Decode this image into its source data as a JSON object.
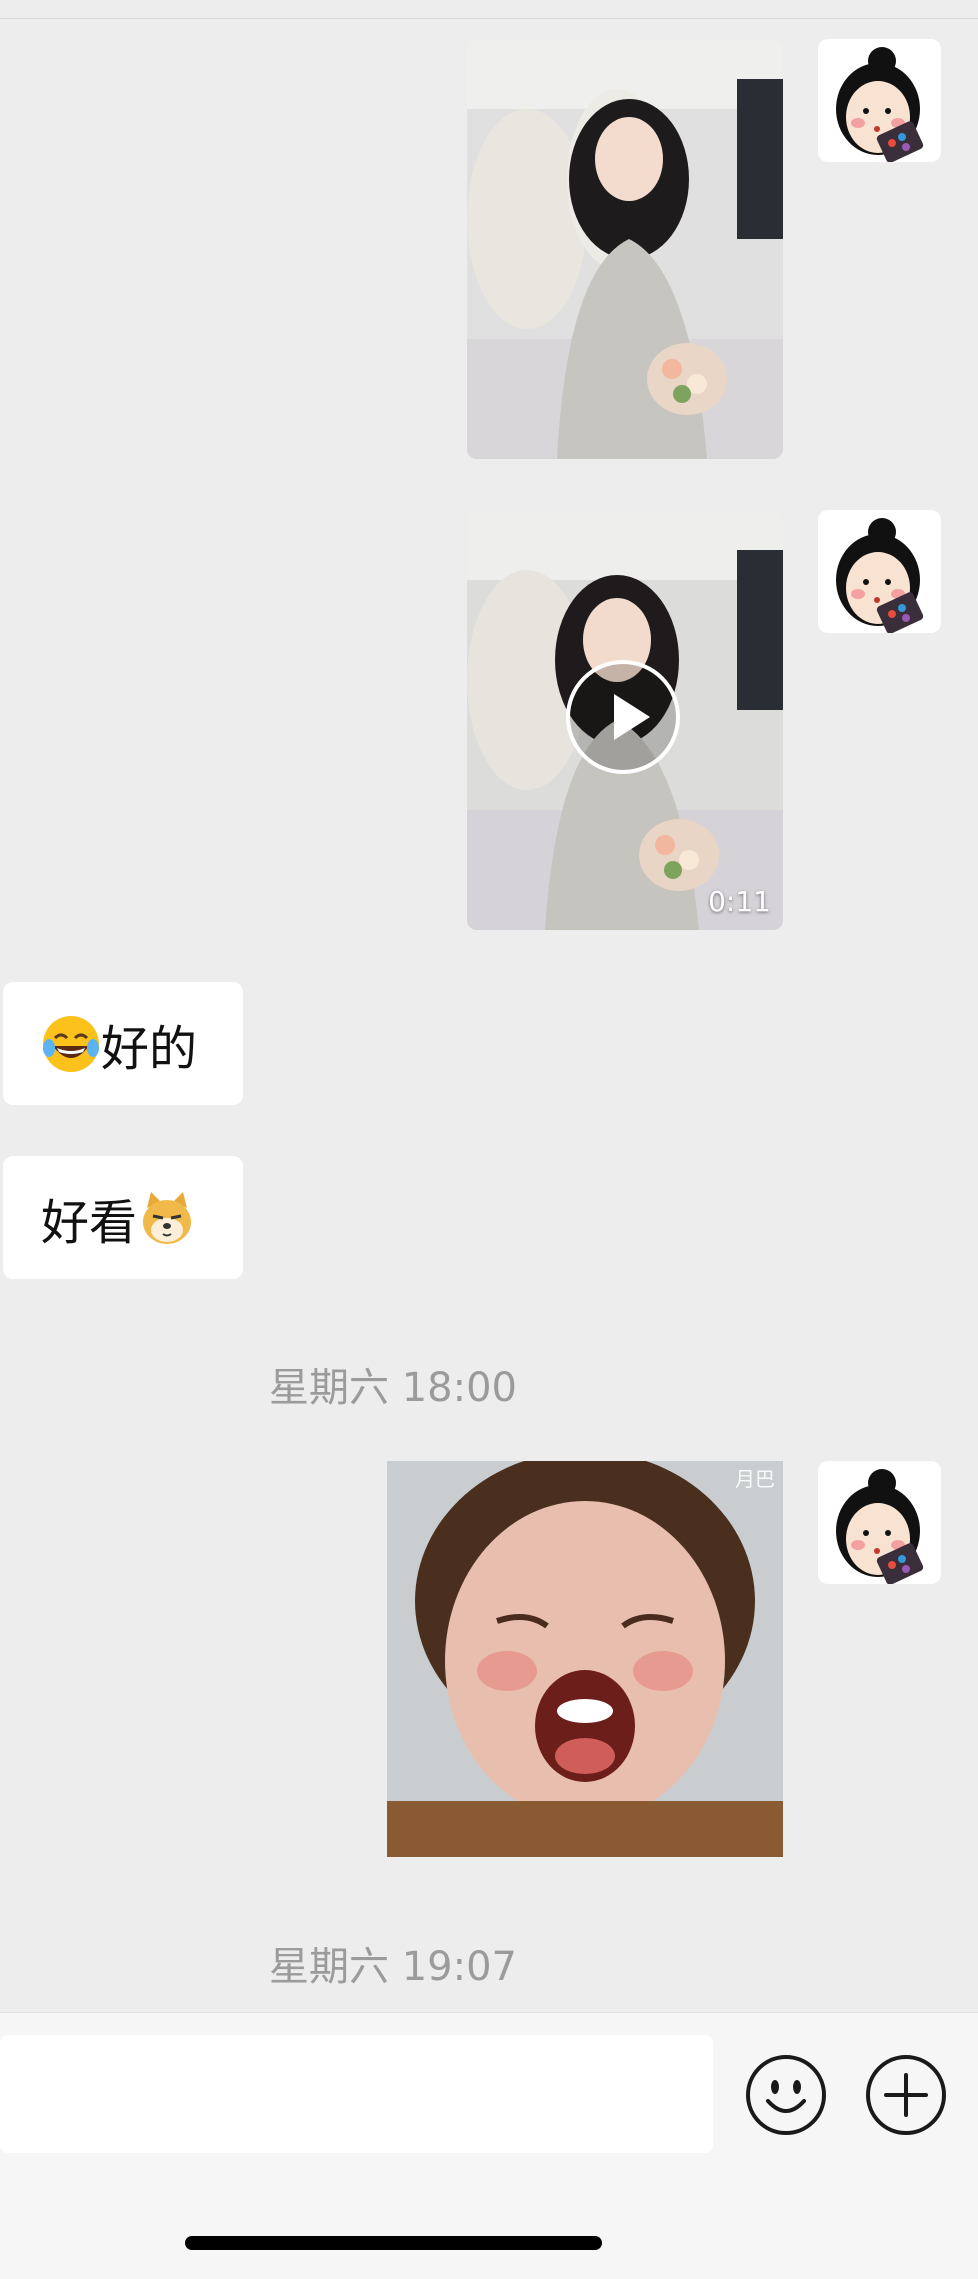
{
  "chat": {
    "video_duration": "0:11",
    "messages": {
      "text1": "好的",
      "text2": "好看"
    },
    "timestamps": [
      "星期六 18:00",
      "星期六 19:07"
    ],
    "meme_watermark": "月巴"
  },
  "icons": {
    "emoji_laugh": "face-with-tears-of-joy",
    "emoji_doge": "doge",
    "emoji_button": "smiley-face",
    "plus_button": "plus-circle"
  },
  "colors": {
    "background": "#ededed",
    "bubble": "#ffffff",
    "timestamp": "#9b9b9b",
    "input_bar": "#f6f6f6"
  }
}
